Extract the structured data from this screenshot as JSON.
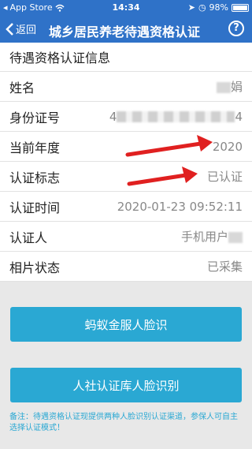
{
  "status_bar": {
    "carrier": "App Store",
    "time": "14:34",
    "battery": "98%"
  },
  "nav": {
    "back_label": "返回",
    "title": "城乡居民养老待遇资格认证",
    "help_label": "?"
  },
  "info": {
    "section_title": "待遇资格认证信息",
    "rows": [
      {
        "label": "姓名",
        "value": "娟"
      },
      {
        "label": "身份证号",
        "value_left": "4",
        "value_right": "4"
      },
      {
        "label": "当前年度",
        "value": "2020"
      },
      {
        "label": "认证标志",
        "value": "已认证"
      },
      {
        "label": "认证时间",
        "value": "2020-01-23 09:52:11"
      },
      {
        "label": "认证人",
        "value": "手机用户"
      },
      {
        "label": "相片状态",
        "value": "已采集"
      }
    ]
  },
  "buttons": {
    "ant_face": "蚂蚁金服人脸识",
    "hr_face": "人社认证库人脸识别"
  },
  "note": "备注：待遇资格认证现提供两种人脸识别认证渠道，参保人可自主选择认证模式！",
  "colors": {
    "header": "#2f72c8",
    "button": "#2aa8d3",
    "arrow": "#e02020"
  }
}
